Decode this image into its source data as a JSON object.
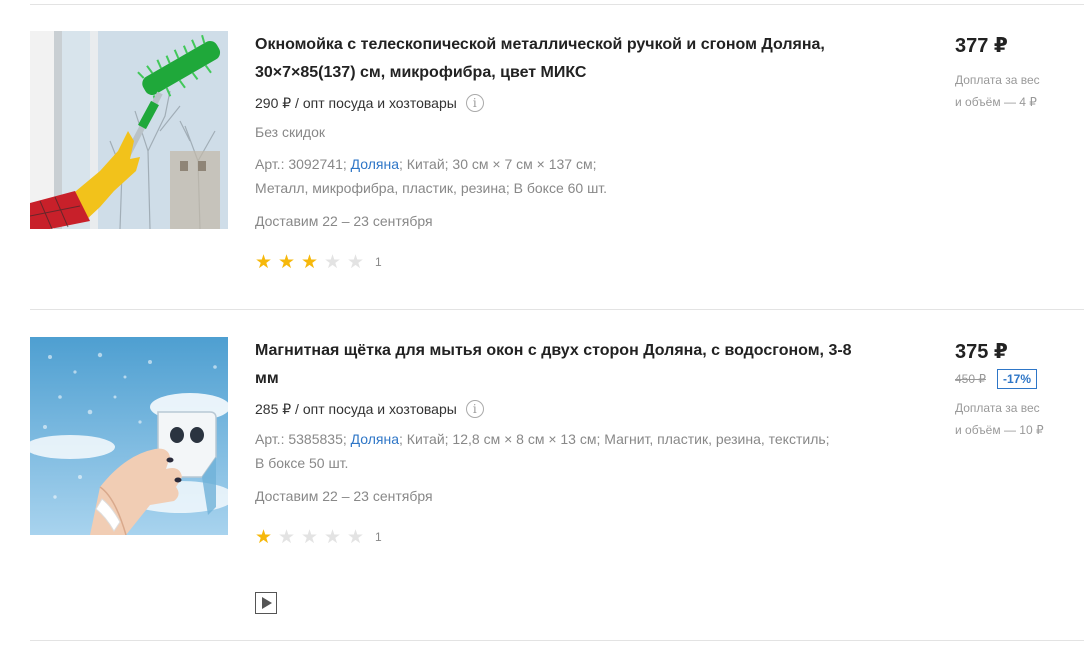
{
  "currency": "₽",
  "colors": {
    "accent": "#2e76c7",
    "star": "#f6b80b",
    "star_empty": "#e3e3e3"
  },
  "products": [
    {
      "title": "Окномойка с телескопической металлической ручкой и сгоном Доляна, 30×7×85(137) см, микрофибра, цвет МИКС",
      "wholesale": "290 ₽ / опт посуда и хозтовары",
      "no_discount": "Без скидок",
      "props_line1_pre": "Арт.: 3092741; ",
      "brand": "Доляна",
      "props_line1_post": "; Китай; 30 см × 7 см × 137 см;",
      "props_line2": "Металл, микрофибра, пластик, резина; В боксе 60 шт.",
      "delivery": "Доставим 22 – 23 сентября",
      "rating": 3,
      "reviews": "1",
      "price": "377 ₽",
      "extra_charge_line1": "Доплата за вес",
      "extra_charge_line2": "и объём — 4 ₽",
      "image_icon": "window-cleaner-photo"
    },
    {
      "title": "Магнитная щётка для мытья окон с двух сторон Доляна, с водосгоном, 3-8 мм",
      "wholesale": "285 ₽ / опт посуда и хозтовары",
      "props_line1_pre": "Арт.: 5385835; ",
      "brand": "Доляна",
      "props_line1_post": "; Китай; 12,8 см × 8 см × 13 см; Магнит, пластик, резина, текстиль;",
      "props_line2": "В боксе 50 шт.",
      "delivery": "Доставим 22 – 23 сентября",
      "rating": 1,
      "reviews": "1",
      "price": "375 ₽",
      "old_price": "450 ₽",
      "discount": "-17%",
      "extra_charge_line1": "Доплата за вес",
      "extra_charge_line2": "и объём — 10 ₽",
      "image_icon": "magnetic-brush-photo",
      "video_icon": "play-icon"
    }
  ]
}
